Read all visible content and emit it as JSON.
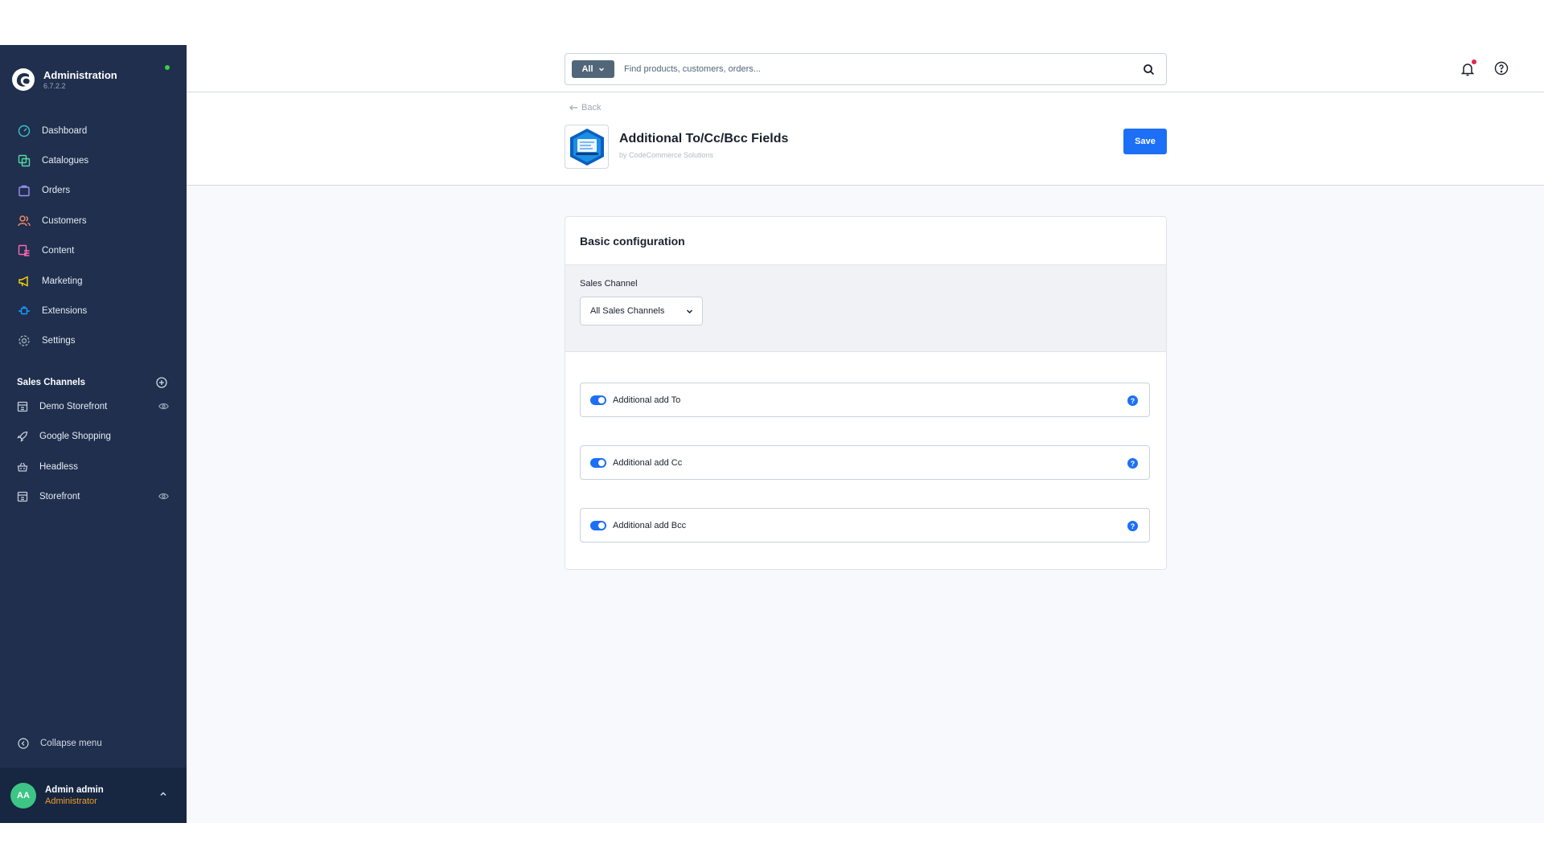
{
  "app": {
    "title": "Administration",
    "version": "6.7.2.2"
  },
  "nav": {
    "items": [
      {
        "label": "Dashboard",
        "icon": "dashboard-icon",
        "color": "#3ec1c9"
      },
      {
        "label": "Catalogues",
        "icon": "catalogue-icon",
        "color": "#57d9a3"
      },
      {
        "label": "Orders",
        "icon": "bag-icon",
        "color": "#a092f0"
      },
      {
        "label": "Customers",
        "icon": "users-icon",
        "color": "#f88962"
      },
      {
        "label": "Content",
        "icon": "content-icon",
        "color": "#ff68b4"
      },
      {
        "label": "Marketing",
        "icon": "megaphone-icon",
        "color": "#ffd700"
      },
      {
        "label": "Extensions",
        "icon": "plug-icon",
        "color": "#189eff"
      },
      {
        "label": "Settings",
        "icon": "gear-icon",
        "color": "#9aa8b5"
      }
    ]
  },
  "sales_channels": {
    "header": "Sales Channels",
    "items": [
      {
        "label": "Demo Storefront",
        "icon": "storefront-icon",
        "visible_toggle": true
      },
      {
        "label": "Google Shopping",
        "icon": "rocket-icon",
        "visible_toggle": false
      },
      {
        "label": "Headless",
        "icon": "basket-icon",
        "visible_toggle": false
      },
      {
        "label": "Storefront",
        "icon": "storefront-icon",
        "visible_toggle": true
      }
    ]
  },
  "sidebar_footer": {
    "collapse_label": "Collapse menu",
    "user_initials": "AA",
    "user_name": "Admin admin",
    "user_role": "Administrator"
  },
  "search": {
    "type_label": "All",
    "placeholder": "Find products, customers, orders..."
  },
  "header": {
    "back_label": "Back",
    "plugin_title": "Additional To/Cc/Bcc Fields",
    "plugin_author": "by CodeCommerce Solutions",
    "save_label": "Save"
  },
  "config": {
    "card_title": "Basic configuration",
    "sales_channel_label": "Sales Channel",
    "sales_channel_value": "All Sales Channels",
    "toggles": [
      {
        "label": "Additional add To",
        "enabled": true
      },
      {
        "label": "Additional add Cc",
        "enabled": true
      },
      {
        "label": "Additional add Bcc",
        "enabled": true
      }
    ]
  },
  "colors": {
    "sidebar_bg": "#1f2f4d",
    "primary": "#1d6ff5",
    "status_online": "#37d046",
    "notification": "#de294c",
    "user_role": "#f39c2b"
  }
}
